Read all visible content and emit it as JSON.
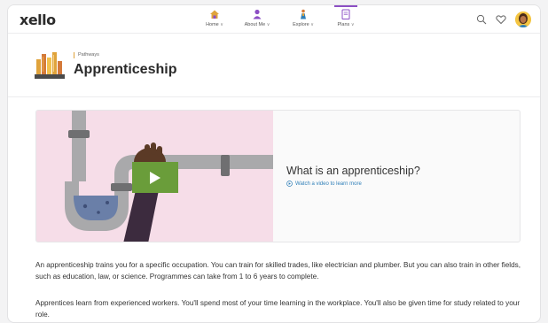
{
  "brand": {
    "logo_text": "xello"
  },
  "nav": {
    "items": [
      {
        "label": "Home",
        "icon": "house-icon"
      },
      {
        "label": "About Me",
        "icon": "person-icon"
      },
      {
        "label": "Explore",
        "icon": "explorer-icon"
      },
      {
        "label": "Plans",
        "icon": "plans-icon",
        "active": true
      }
    ],
    "chevron": "∨"
  },
  "header": {
    "breadcrumb": "Pathways",
    "title": "Apprenticeship"
  },
  "video": {
    "title": "What is an apprenticeship?",
    "link": "Watch a video to learn more"
  },
  "content": {
    "paragraph_1": "An apprenticeship trains you for a specific occupation. You can train for skilled trades, like electrician and plumber. But you can also train in other fields, such as education, law, or science. Programmes can take from 1 to 6 years to complete.",
    "paragraph_2": "Apprentices learn from experienced workers. You'll spend most of your time learning in the workplace. You'll also be given time for study related to your role."
  },
  "colors": {
    "accent": "#8c4fc4",
    "play_button": "#6a9d3a",
    "thumbnail_bg": "#f6dde8",
    "link": "#2f7fb8"
  }
}
